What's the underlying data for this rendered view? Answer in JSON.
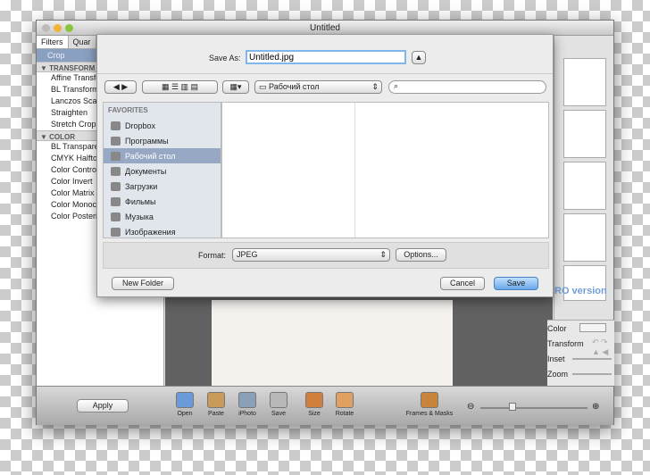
{
  "window": {
    "title": "Untitled"
  },
  "left_panel": {
    "tabs": [
      "Filters",
      "Quar"
    ],
    "crop": "Crop",
    "sections": [
      {
        "title": "TRANSFORM",
        "items": [
          "Affine Transform",
          "BL Transform",
          "Lanczos Scale",
          "Straighten",
          "Stretch Crop"
        ]
      },
      {
        "title": "COLOR",
        "items": [
          "BL Transparency",
          "CMYK Halftone",
          "Color Controls",
          "Color Invert",
          "Color Matrix",
          "Color Monochrome",
          "Color Posterize"
        ]
      }
    ]
  },
  "sheet": {
    "save_as_label": "Save As:",
    "filename": "Untitled.jpg",
    "location": "Рабочий стол",
    "search_placeholder": "",
    "favorites_header": "FAVORITES",
    "favorites": [
      {
        "label": "Dropbox",
        "icon": "folder-icon"
      },
      {
        "label": "Программы",
        "icon": "applications-icon"
      },
      {
        "label": "Рабочий стол",
        "icon": "desktop-icon",
        "selected": true
      },
      {
        "label": "Документы",
        "icon": "documents-icon"
      },
      {
        "label": "Загрузки",
        "icon": "downloads-icon"
      },
      {
        "label": "Фильмы",
        "icon": "movies-icon"
      },
      {
        "label": "Музыка",
        "icon": "music-icon"
      },
      {
        "label": "Изображения",
        "icon": "pictures-icon"
      }
    ],
    "format_label": "Format:",
    "format_value": "JPEG",
    "options_label": "Options...",
    "new_folder_label": "New Folder",
    "cancel_label": "Cancel",
    "save_label": "Save"
  },
  "right_panel": {
    "watermark": "RO version",
    "color_label": "Color",
    "transform_label": "Transform",
    "inset_label": "Inset",
    "zoom_label": "Zoom"
  },
  "toolbar": {
    "apply_label": "Apply",
    "tools": [
      "Open",
      "Paste",
      "iPhoto",
      "Save",
      "Size",
      "Rotate",
      "Frames & Masks"
    ],
    "zoom_level": 0.3
  },
  "colors": {
    "accent": "#4a90e2",
    "selection": "#97a8c4",
    "save_button": "#7fb6ee"
  }
}
